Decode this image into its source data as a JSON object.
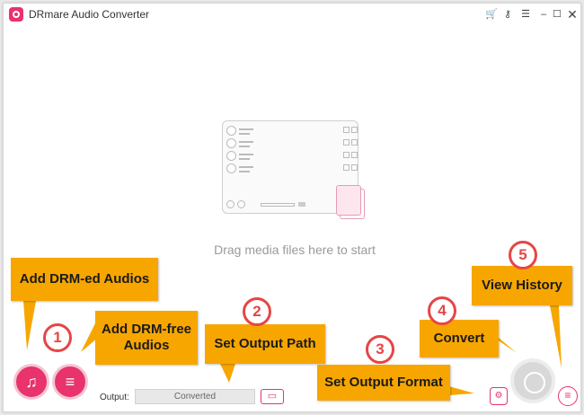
{
  "window": {
    "title": "DRmare Audio Converter"
  },
  "titlebar_icons": [
    "cart-icon",
    "key-icon",
    "menu-icon",
    "minimize-icon",
    "maximize-icon",
    "close-icon"
  ],
  "main": {
    "hint": "Drag media files here to start"
  },
  "footer": {
    "output_label": "Output:",
    "output_value": "Converted"
  },
  "callouts": {
    "add_drm": "Add DRM-ed Audios",
    "add_free": "Add DRM-free Audios",
    "output_path": "Set Output Path",
    "output_format": "Set Output Format",
    "convert": "Convert",
    "history": "View History"
  },
  "numbers": [
    "1",
    "2",
    "3",
    "4",
    "5"
  ],
  "colors": {
    "accent": "#e8336d",
    "callout": "#f7a600",
    "number_ring": "#e64545"
  }
}
